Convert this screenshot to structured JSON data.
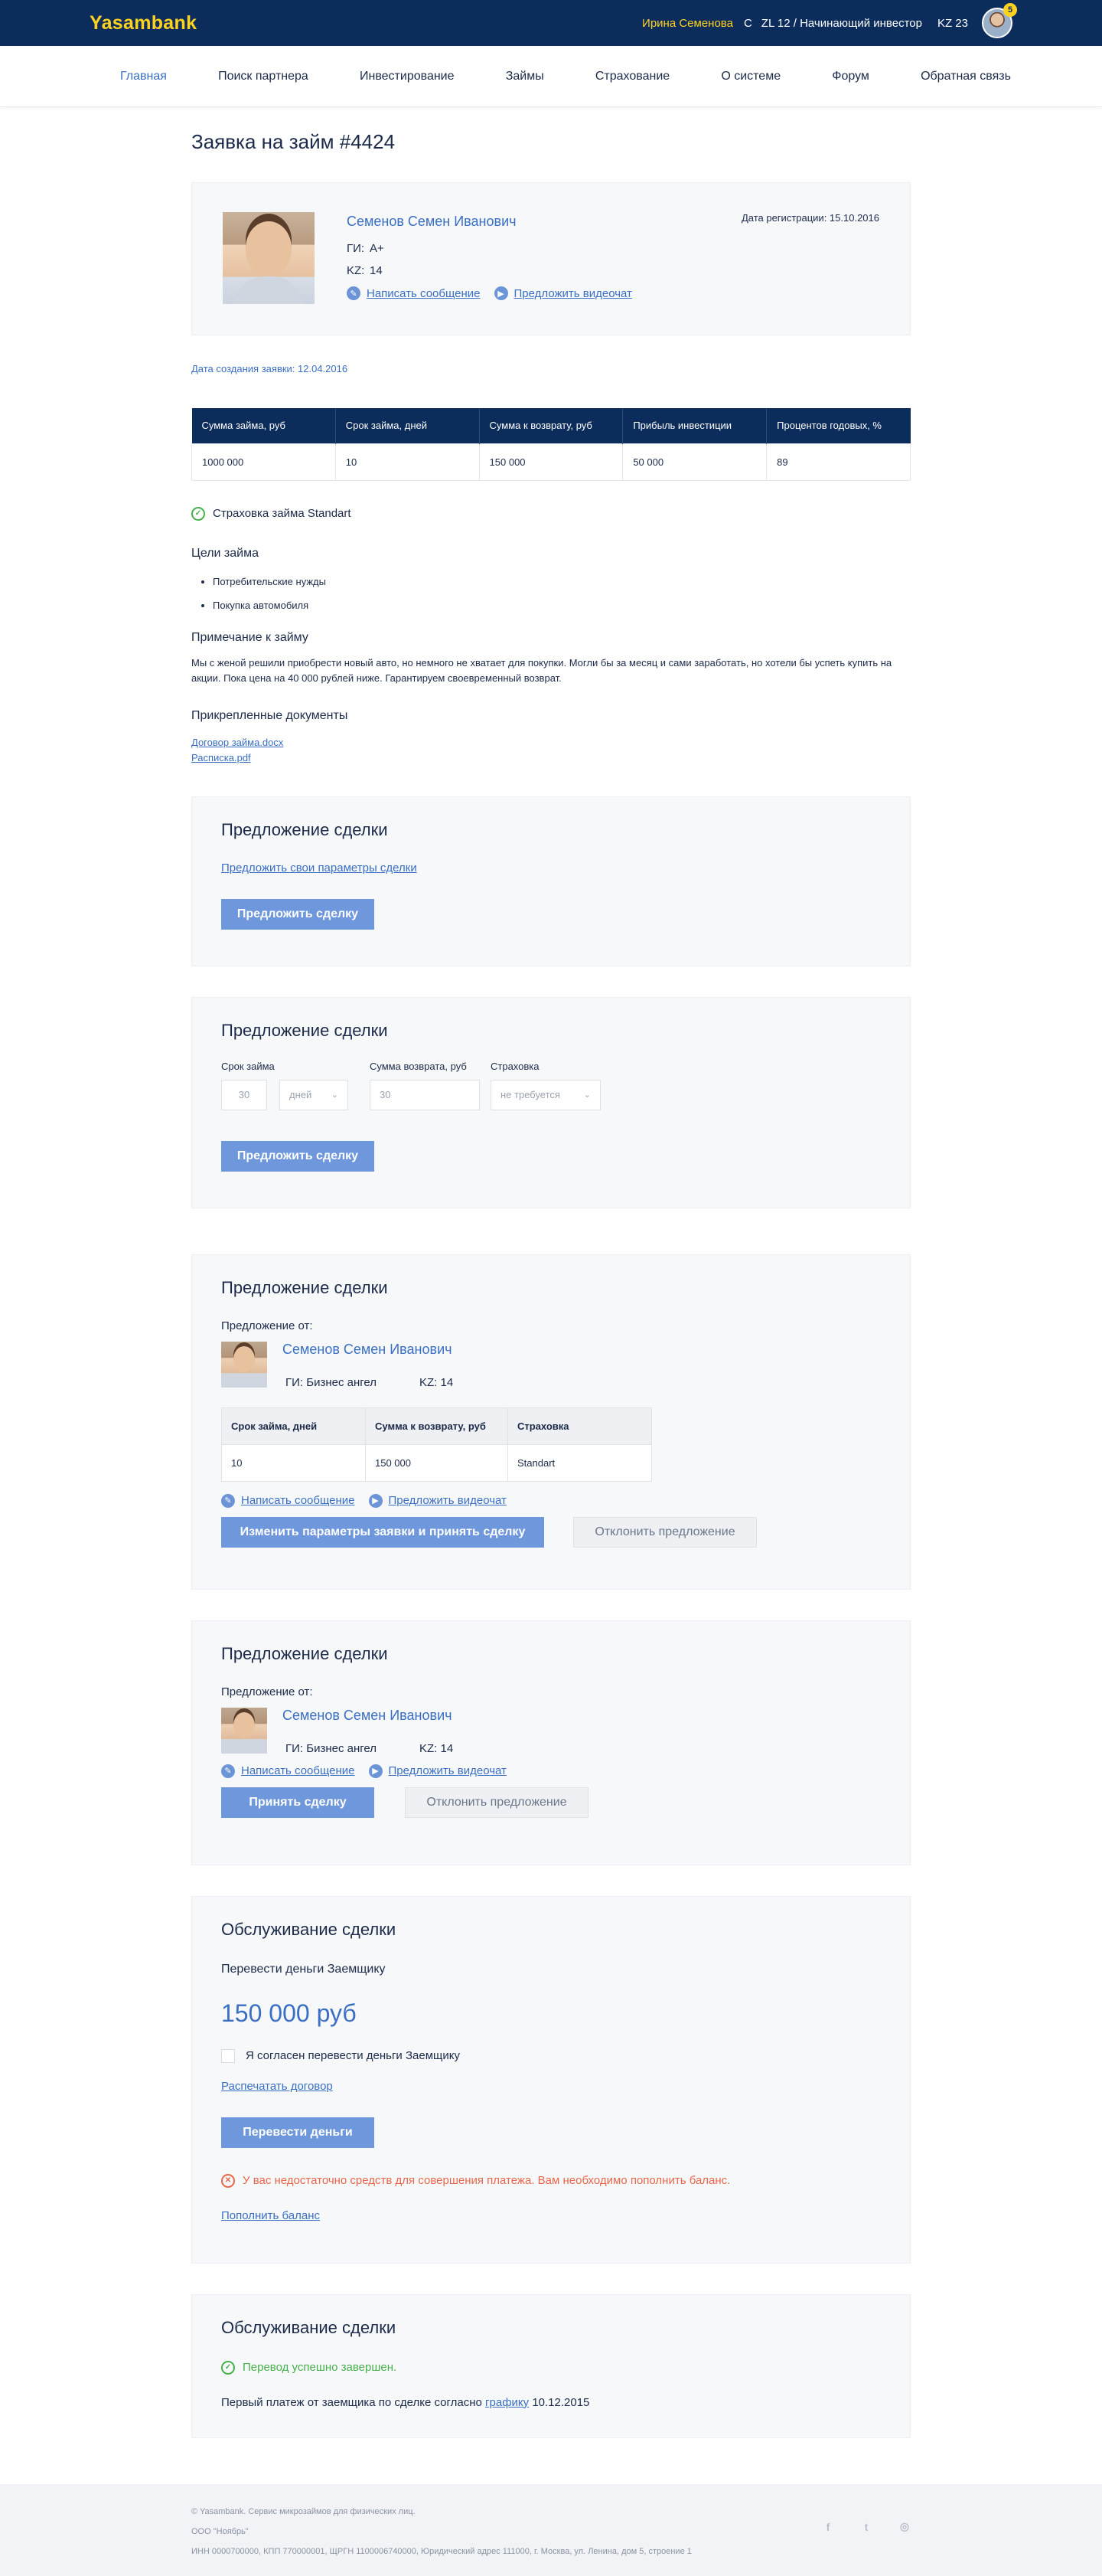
{
  "header": {
    "logo": "Yasambank",
    "user_name": "Ирина Семенова",
    "user_sep": "C",
    "zl_status": "ZL 12 / Начинающий инвестор",
    "kz": "KZ 23",
    "notifications": "5"
  },
  "nav": {
    "items": [
      "Главная",
      "Поиск партнера",
      "Инвестирование",
      "Займы",
      "Страхование",
      "О системе",
      "Форум",
      "Обратная связь"
    ]
  },
  "page": {
    "title": "Заявка на займ #4424"
  },
  "borrower": {
    "name": "Семенов Семен Иванович",
    "gi_label": "ГИ:",
    "gi_value": "A+",
    "kz_label": "KZ:",
    "kz_value": "14",
    "write_message": "Написать сообщение",
    "offer_video": "Предложить видеочат",
    "reg_date": "Дата регистрации: 15.10.2016"
  },
  "application": {
    "created": "Дата создания заявки: 12.04.2016",
    "table_headers": [
      "Сумма займа, руб",
      "Срок займа, дней",
      "Сумма к возврату, руб",
      "Прибыль инвестиции",
      "Процентов годовых, %"
    ],
    "table_values": [
      "1000 000",
      "10",
      "150 000",
      "50 000",
      "89"
    ],
    "insurance": "Страховка займа Standart",
    "goals_title": "Цели займа",
    "goals": [
      "Потребительские нужды",
      "Покупка автомобиля"
    ],
    "note_title": "Примечание к займу",
    "note_text": "Мы с женой решили приобрести новый авто, но немного не хватает для покупки. Могли бы за месяц и сами заработать, но хотели бы успеть купить на акции. Пока цена на 40 000 рублей ниже. Гарантируем своевременный возврат.",
    "docs_title": "Прикрепленные документы",
    "docs": [
      "Договор займа.docx",
      "Расписка.pdf"
    ]
  },
  "deal1": {
    "title": "Предложение сделки",
    "link": "Предложить свои параметры сделки",
    "button": "Предложить сделку"
  },
  "deal2": {
    "title": "Предложение сделки",
    "term_label": "Срок займа",
    "return_label": "Сумма возврата, руб",
    "insurance_label": "Страховка",
    "term_value": "30",
    "term_unit": "дней",
    "return_value": "30",
    "insurance_value": "не требуется",
    "button": "Предложить сделку"
  },
  "deal3": {
    "title": "Предложение сделки",
    "offer_from": "Предложение от:",
    "name": "Семенов Семен Иванович",
    "gi": "ГИ: Бизнес ангел",
    "kz": "KZ: 14",
    "table_headers": [
      "Срок займа, дней",
      "Сумма к возврату, руб",
      "Страховка"
    ],
    "table_values": [
      "10",
      "150 000",
      "Standart"
    ],
    "write_message": "Написать сообщение",
    "offer_video": "Предложить видеочат",
    "accept_button": "Изменить параметры заявки и принять сделку",
    "decline_button": "Отклонить предложение"
  },
  "deal4": {
    "title": "Предложение сделки",
    "offer_from": "Предложение от:",
    "name": "Семенов Семен Иванович",
    "gi": "ГИ: Бизнес ангел",
    "kz": "KZ: 14",
    "write_message": "Написать сообщение",
    "offer_video": "Предложить видеочат",
    "accept_button": "Принять сделку",
    "decline_button": "Отклонить предложение"
  },
  "service1": {
    "title": "Обслуживание сделки",
    "transfer_label": "Перевести деньги Заемщику",
    "amount": "150 000 руб",
    "agree": "Я согласен перевести деньги Заемщику",
    "print_link": "Распечатать договор",
    "button": "Перевести деньги",
    "error": "У вас недостаточно средств для совершения платежа. Вам необходимо пополнить баланс.",
    "topup_link": "Пополнить баланс"
  },
  "service2": {
    "title": "Обслуживание сделки",
    "success": "Перевод успешно завершен.",
    "first_payment_prefix": "Первый платеж от заемщика по сделке согласно",
    "schedule_link": "графику",
    "first_payment_date": "10.12.2015"
  },
  "footer": {
    "line1": "© Yasambank. Сервис микрозаймов для физических лиц.",
    "line2": "ООО \"Ноябрь\"",
    "line3": "ИНН 0000700000, КПП 770000001, ЩРГН 1100006740000, Юридический адрес 111000, г. Москва, ул. Ленина, дом 5, строение 1",
    "socials": [
      "facebook-icon",
      "twitter-icon",
      "instagram-icon"
    ]
  },
  "colors": {
    "header_bg": "#0c2c5c",
    "logo": "#ffd21f",
    "accent": "#3a6fc4",
    "button": "#6e97dc",
    "success": "#46b04a",
    "error": "#e8674a"
  }
}
